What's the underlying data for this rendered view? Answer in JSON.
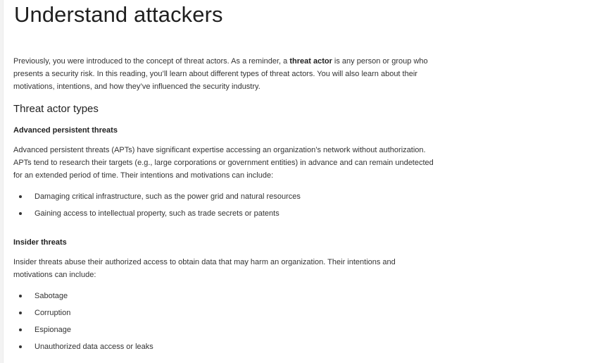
{
  "title": "Understand attackers",
  "intro": {
    "part1": "Previously, you were introduced to the concept of threat actors. As a reminder, a ",
    "term": "threat actor",
    "part2": " is any person or group who presents a security risk. In this reading, you’ll learn about different types of threat actors. You will also learn about their motivations, intentions, and how they’ve influenced the security industry."
  },
  "section": {
    "heading": "Threat actor types",
    "apt": {
      "heading": "Advanced persistent threats",
      "body": "Advanced persistent threats (APTs) have significant expertise accessing an organization’s network without authorization. APTs tend to research their targets (e.g., large corporations or government entities)  in advance and can remain undetected for an extended period of time. Their intentions and motivations can include:",
      "bullets": [
        "Damaging critical infrastructure, such as the power grid and natural resources",
        "Gaining access to intellectual property, such as trade secrets or patents"
      ]
    },
    "insider": {
      "heading": "Insider threats",
      "body": "Insider threats abuse their authorized access to obtain data that may harm an organization. Their intentions and motivations can include:",
      "bullets": [
        "Sabotage",
        "Corruption",
        "Espionage",
        "Unauthorized data access or leaks"
      ]
    }
  }
}
